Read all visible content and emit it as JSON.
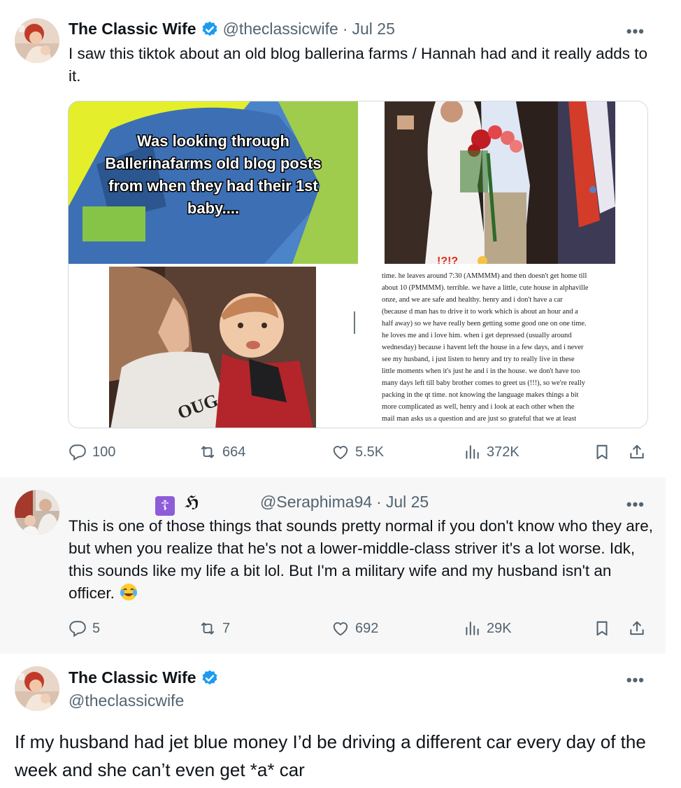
{
  "colors": {
    "verified": "#1d9bf0",
    "text_primary": "#0f1419",
    "text_secondary": "#536471",
    "thread_line": "#cfd9de",
    "reply_background": "#f7f7f7"
  },
  "tweet1": {
    "author_name": "The Classic Wife",
    "handle": "@theclassicwife",
    "separator": "·",
    "date": "Jul 25",
    "more": "•••",
    "text": "I saw this tiktok about an old blog ballerina farms / Hannah had and it really adds to it.",
    "media": {
      "overlay_lines": [
        "Was looking through",
        "Ballerinafarms old blog posts",
        "from when they had their 1st",
        "baby...."
      ],
      "shirt_letters": "OUGAR",
      "article_lines": [
        "time. he leaves around 7:30 (AMMMM) and then doesn't get home till",
        "about 10 (PMMMM). terrible. we have a little, cute house in alphaville",
        "onze, and we are safe and healthy. henry and i don't have a car",
        "(because d man has to drive it to work which is about an hour and a",
        "half away) so we have really been getting some good one on one time.",
        "he loves me and i love him. when i get depressed (usually around",
        "wednesday) because i havent left the house in a few days, and i never",
        "see my husband, i just listen to henry and try to really live in these",
        "little moments when it's just he and i in the house. we don't have too",
        "many days left till baby brother comes to greet us (!!!), so we're really",
        "packing in the qt time. not knowing the language makes things a bit",
        "more complicated as well, henry and i look at each other when the",
        "mail man asks us a question and are just so grateful that we at least"
      ]
    },
    "actions": {
      "replies": "100",
      "reposts": "664",
      "likes": "5.5K",
      "views": "372K"
    }
  },
  "tweet2": {
    "author_glyphs": "☦ ℌ",
    "handle": "@Seraphima94",
    "separator": "·",
    "date": "Jul 25",
    "more": "•••",
    "text": "This is one of those things that sounds pretty normal if you don't know who they are, but when you realize that he's not a lower-middle-class striver it's a lot worse. Idk, this sounds like my life a bit lol. But I'm a military wife and my husband isn't an officer.",
    "emoji": "face-with-tears-of-joy",
    "actions": {
      "replies": "5",
      "reposts": "7",
      "likes": "692",
      "views": "29K"
    }
  },
  "tweet3": {
    "author_name": "The Classic Wife",
    "handle": "@theclassicwife",
    "more": "•••",
    "text": "If my husband had jet blue money I’d be driving a different car every day of the week and she can’t even get *a* car"
  }
}
